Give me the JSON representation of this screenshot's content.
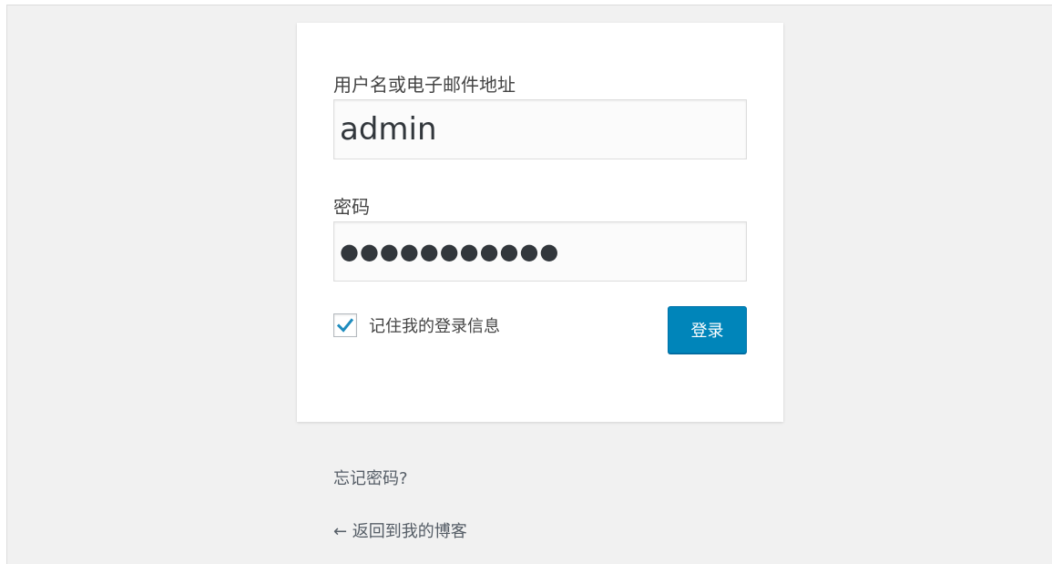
{
  "login_form": {
    "username_label": "用户名或电子邮件地址",
    "username_value": "admin",
    "password_label": "密码",
    "password_masked": "●●●●●●●●●●●",
    "remember_label": "记住我的登录信息",
    "remember_checked": true,
    "submit_label": "登录"
  },
  "links": {
    "lost_password": "忘记密码?",
    "back_to_blog": "← 返回到我的博客"
  },
  "colors": {
    "background": "#f1f1f1",
    "panel": "#ffffff",
    "primary_button": "#0085ba",
    "checkmark": "#1e8cbe",
    "text": "#444444"
  },
  "icons": {
    "checkbox_check": "check-icon"
  }
}
